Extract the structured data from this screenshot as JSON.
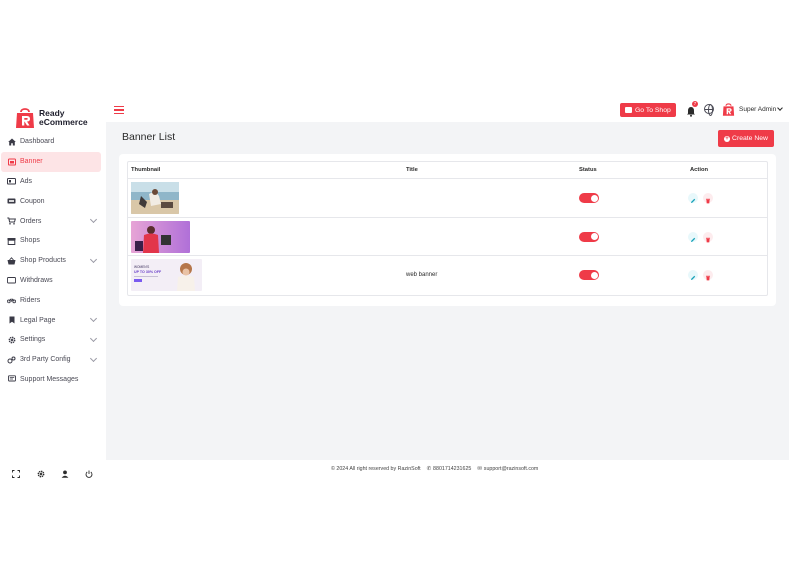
{
  "brand": {
    "line1": "Ready",
    "line2": "eCommerce",
    "color": "#ef3b48"
  },
  "sidebar": {
    "items": [
      {
        "label": "Dashboard",
        "icon": "home-icon",
        "active": false,
        "expandable": false
      },
      {
        "label": "Banner",
        "icon": "banner-icon",
        "active": true,
        "expandable": false
      },
      {
        "label": "Ads",
        "icon": "ads-icon",
        "active": false,
        "expandable": false
      },
      {
        "label": "Coupon",
        "icon": "coupon-icon",
        "active": false,
        "expandable": false
      },
      {
        "label": "Orders",
        "icon": "cart-icon",
        "active": false,
        "expandable": true
      },
      {
        "label": "Shops",
        "icon": "store-icon",
        "active": false,
        "expandable": false
      },
      {
        "label": "Shop Products",
        "icon": "basket-icon",
        "active": false,
        "expandable": true
      },
      {
        "label": "Withdraws",
        "icon": "wallet-icon",
        "active": false,
        "expandable": false
      },
      {
        "label": "Riders",
        "icon": "bike-icon",
        "active": false,
        "expandable": false
      },
      {
        "label": "Legal Page",
        "icon": "bookmark-icon",
        "active": false,
        "expandable": true
      },
      {
        "label": "Settings",
        "icon": "gear-icon",
        "active": false,
        "expandable": true
      },
      {
        "label": "3rd Party Config",
        "icon": "gears-icon",
        "active": false,
        "expandable": true
      },
      {
        "label": "Support Messages",
        "icon": "message-icon",
        "active": false,
        "expandable": false
      }
    ]
  },
  "header": {
    "go_to_shop": "Go To Shop",
    "notification_count": "7",
    "user_name": "Super Admin"
  },
  "main": {
    "title": "Banner List",
    "create_button": "Create New",
    "table": {
      "columns": [
        "Thumbnail",
        "Title",
        "Status",
        "Action"
      ],
      "rows": [
        {
          "title": "",
          "status": "on",
          "thumb": "beach-photo"
        },
        {
          "title": "",
          "status": "on",
          "thumb": "sale-photo"
        },
        {
          "title": "web banner",
          "status": "on",
          "thumb": "web-banner-photo"
        }
      ]
    }
  },
  "thumb_text": {
    "line1": "WOMEN'S",
    "line2": "UP TO 30% OFF"
  },
  "footer": {
    "copyright": "© 2024 All right reserved by RazinSoft",
    "phone": "8801714231625",
    "email": "support@razinsoft.com"
  },
  "colors": {
    "accent": "#ef3b48",
    "edit": "#17a2b8",
    "background": "#f3f4f6"
  }
}
